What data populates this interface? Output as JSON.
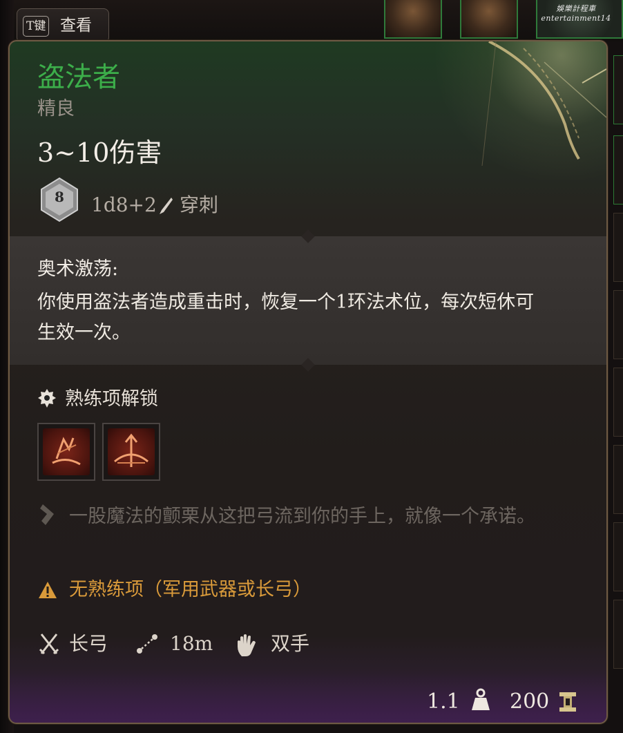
{
  "hotkey": {
    "key": "T键",
    "label": "查看"
  },
  "watermark": {
    "line1": "娛樂計程車",
    "line2": "entertainment14"
  },
  "item": {
    "name": "盗法者",
    "rarity": "精良",
    "damage": "3~10伤害",
    "die_face": "8",
    "damage_formula": "1d8+2",
    "damage_type": "穿刺"
  },
  "ability": {
    "title": "奥术激荡:",
    "description": "你使用盗法者造成重击时，恢复一个1环法术位，每次短休可生效一次。"
  },
  "proficiency": {
    "label": "熟练项解锁",
    "skills": [
      "skill-icon-1",
      "skill-icon-2"
    ]
  },
  "flavor_text": "一股魔法的颤栗从这把弓流到你的手上，就像一个承诺。",
  "warning": "无熟练项（军用武器或长弓）",
  "stats": {
    "weapon_type": "长弓",
    "range": "18m",
    "handedness": "双手"
  },
  "footer": {
    "weight": "1.1",
    "price": "200"
  },
  "colors": {
    "name": "#3cae4a",
    "warning": "#d99a3a",
    "flavor": "#6d6660"
  }
}
